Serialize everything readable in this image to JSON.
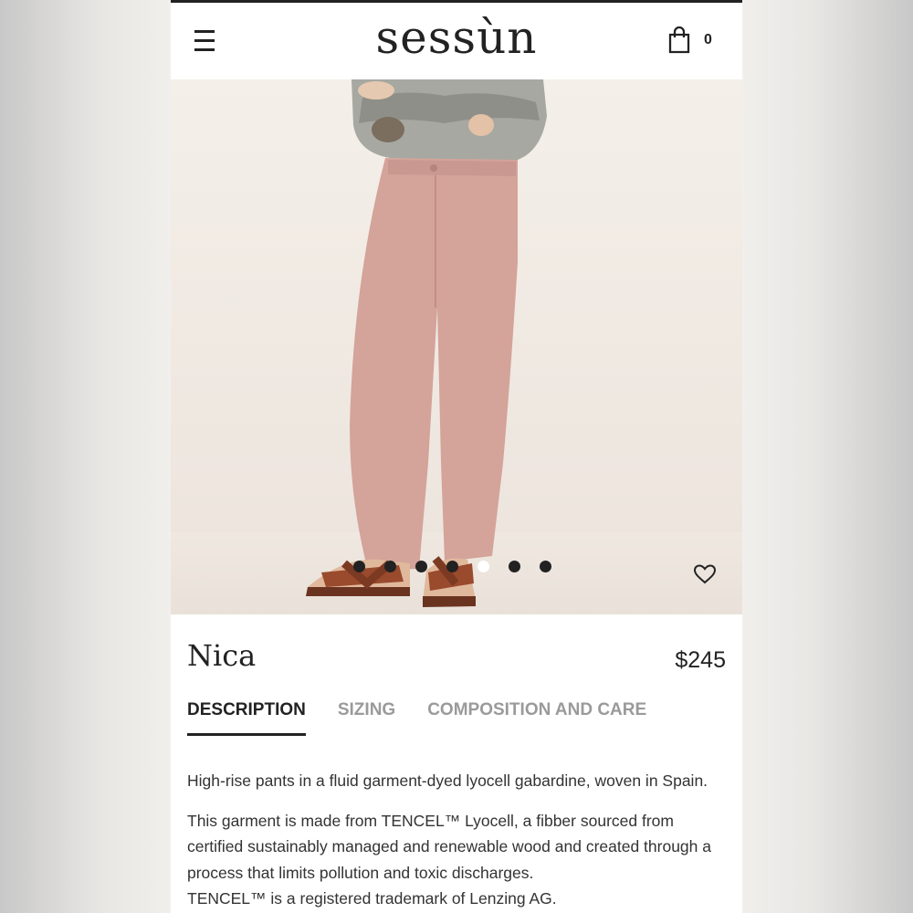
{
  "header": {
    "logo": "sessùn",
    "cart_count": "0"
  },
  "icons": {
    "menu": "hamburger-menu-icon",
    "cart": "shopping-bag-icon",
    "wishlist": "heart-icon"
  },
  "gallery": {
    "image_count": 7,
    "active_index": 4
  },
  "product": {
    "name": "Nica",
    "price": "$245"
  },
  "tabs": [
    {
      "label": "DESCRIPTION",
      "active": true
    },
    {
      "label": "SIZING",
      "active": false
    },
    {
      "label": "COMPOSITION AND CARE",
      "active": false
    }
  ],
  "description": {
    "intro": "High-rise pants in a fluid garment-dyed lyocell gabardine, woven in Spain.",
    "line1": "This garment is made from TENCEL™ Lyocell, a fibber sourced from certified sustainably managed and renewable wood and created through a process that limits pollution and toxic discharges.",
    "line2": "TENCEL™ is a registered trademark of Lenzing AG."
  },
  "colors": {
    "text": "#222222",
    "muted_tab": "#9a9a9a",
    "pants": "#d4a39a",
    "background": "#f1ece6"
  }
}
